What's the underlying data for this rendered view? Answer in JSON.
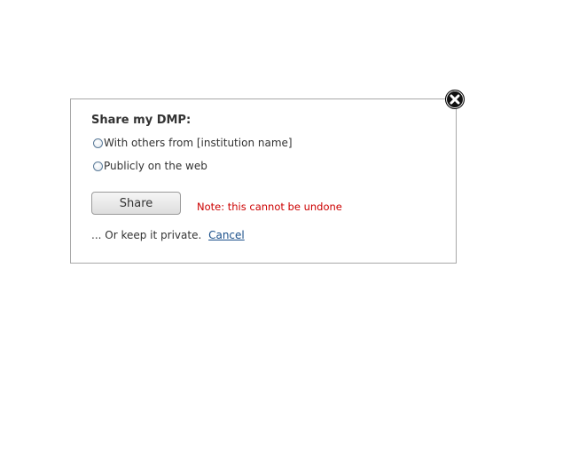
{
  "dialog": {
    "title": "Share my DMP:",
    "options": [
      {
        "label": "With others from [institution name]",
        "selected": false
      },
      {
        "label": "Publicly on the web",
        "selected": false
      }
    ],
    "share_button_label": "Share",
    "note": "Note: this cannot be undone",
    "keep_private_text": "... Or keep it private.",
    "cancel_link_label": "Cancel",
    "close_icon": "close-icon"
  },
  "colors": {
    "note": "#cc0000",
    "link": "#1a4f8a",
    "border": "#a8a8a8"
  }
}
